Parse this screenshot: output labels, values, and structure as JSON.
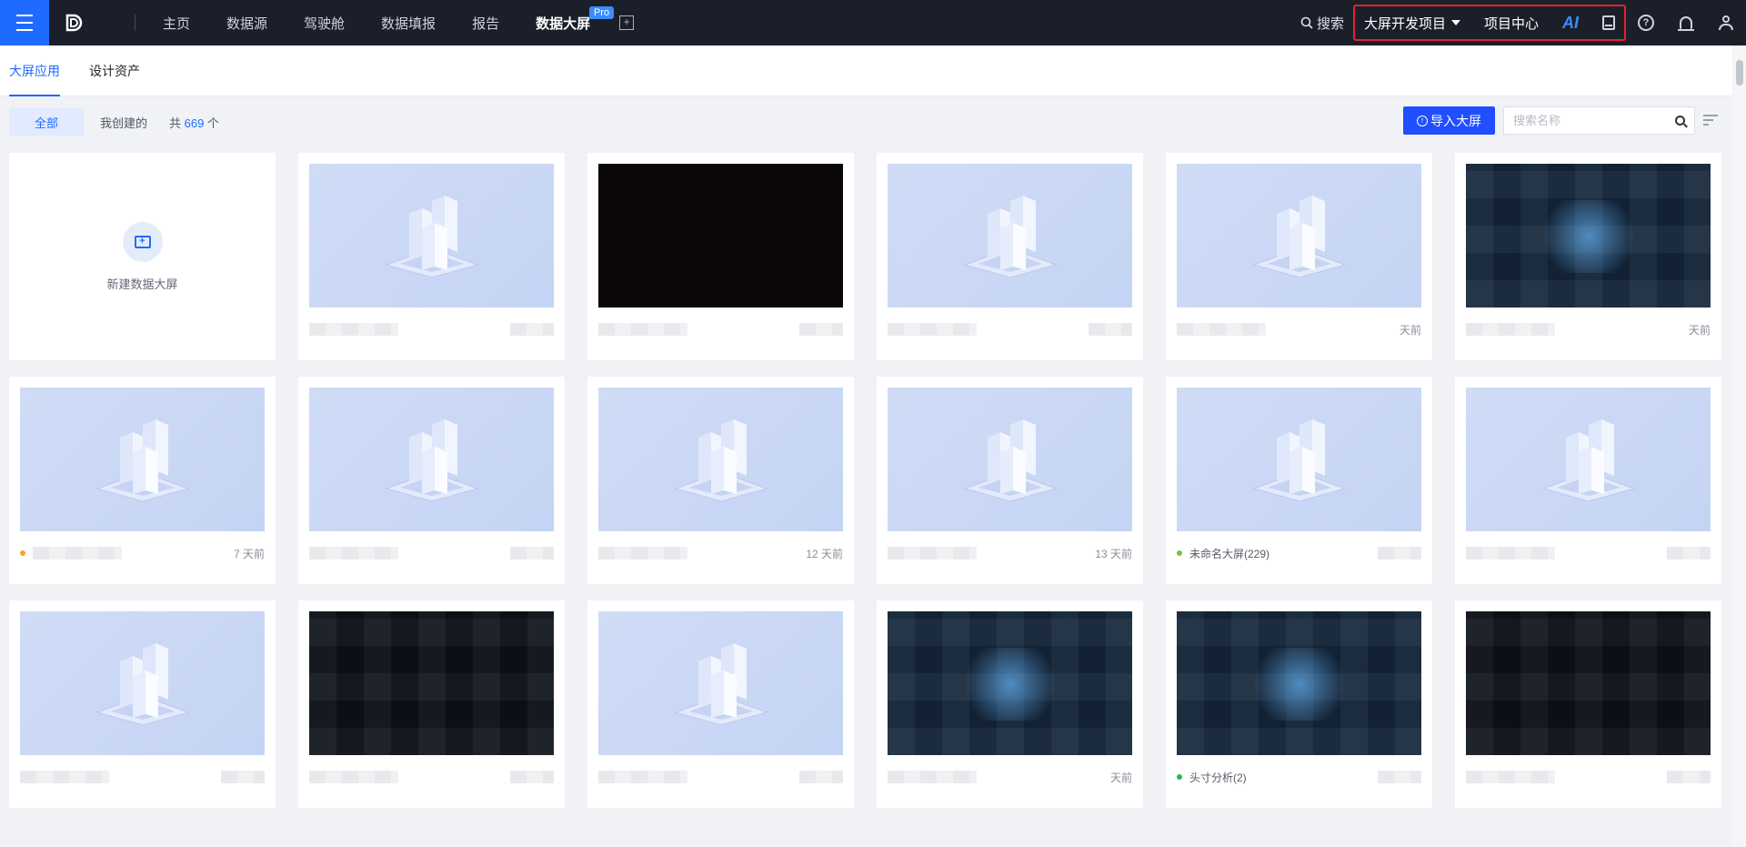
{
  "topbar": {
    "nav": [
      "主页",
      "数据源",
      "驾驶舱",
      "数据填报",
      "报告",
      "数据大屏"
    ],
    "active_nav": "数据大屏",
    "pro_badge": "Pro",
    "search_label": "搜索",
    "project_select": "大屏开发项目",
    "project_center": "项目中心",
    "ai_label": "AI",
    "help_glyph": "?",
    "add_glyph": "+",
    "icons": [
      "menu-icon",
      "logo-icon",
      "add-tab-icon",
      "search-icon",
      "book-icon",
      "help-icon",
      "bell-icon",
      "user-icon"
    ]
  },
  "tabs": [
    "大屏应用",
    "设计资产"
  ],
  "filters": {
    "all": "全部",
    "mine": "我创建的",
    "count_prefix": "共",
    "count": "669",
    "count_suffix": "个",
    "import_label": "导入大屏",
    "search_placeholder": "搜索名称"
  },
  "new_card": {
    "label": "新建数据大屏",
    "glyph": "+"
  },
  "cards": [
    {
      "thumb": "placeholder",
      "time": ""
    },
    {
      "thumb": "black",
      "time": ""
    },
    {
      "thumb": "placeholder",
      "time": ""
    },
    {
      "thumb": "placeholder",
      "time": "天前"
    },
    {
      "thumb": "scene",
      "time": "天前"
    },
    {
      "thumb": "placeholder",
      "time": "7 天前",
      "dot": "#f5a623"
    },
    {
      "thumb": "placeholder",
      "time": ""
    },
    {
      "thumb": "placeholder",
      "time": "12 天前"
    },
    {
      "thumb": "placeholder",
      "time": "13 天前"
    },
    {
      "thumb": "placeholder",
      "name": "未命名大屏(229)",
      "time": "",
      "dot": "#7cc242"
    },
    {
      "thumb": "placeholder",
      "time": ""
    },
    {
      "thumb": "placeholder",
      "time": ""
    },
    {
      "thumb": "dark",
      "time": ""
    },
    {
      "thumb": "placeholder",
      "time": ""
    },
    {
      "thumb": "scene",
      "time": "天前"
    },
    {
      "thumb": "scene",
      "name": "头寸分析(2)",
      "time": "",
      "dot": "#2ab74a"
    },
    {
      "thumb": "dark",
      "time": ""
    }
  ],
  "colors": {
    "accent": "#1f6bff",
    "nav_bg": "#1b1f2a",
    "highlight": "#e0242e"
  }
}
